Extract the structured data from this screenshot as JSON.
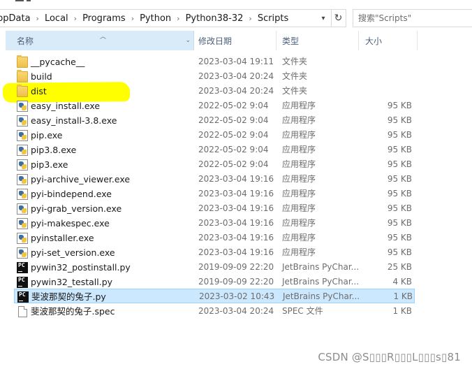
{
  "address": {
    "crumbs": [
      "ppData",
      "Local",
      "Programs",
      "Python",
      "Python38-32",
      "Scripts"
    ],
    "separator": "›",
    "dropdown_icon": "chevron-down-icon",
    "refresh_icon": "refresh-icon"
  },
  "search": {
    "placeholder": "搜索\"Scripts\""
  },
  "columns": {
    "name": "名称",
    "date": "修改日期",
    "type": "类型",
    "size": "大小"
  },
  "files": [
    {
      "name": "__pycache__",
      "date": "2023-03-04 19:11",
      "type": "文件夹",
      "size": "",
      "icon": "folder-icon"
    },
    {
      "name": "build",
      "date": "2023-03-04 20:24",
      "type": "文件夹",
      "size": "",
      "icon": "folder-icon"
    },
    {
      "name": "dist",
      "date": "2023-03-04 20:24",
      "type": "文件夹",
      "size": "",
      "icon": "folder-icon"
    },
    {
      "name": "easy_install.exe",
      "date": "2022-05-02 9:04",
      "type": "应用程序",
      "size": "95 KB",
      "icon": "python-exe-icon"
    },
    {
      "name": "easy_install-3.8.exe",
      "date": "2022-05-02 9:04",
      "type": "应用程序",
      "size": "95 KB",
      "icon": "python-exe-icon"
    },
    {
      "name": "pip.exe",
      "date": "2022-05-02 9:04",
      "type": "应用程序",
      "size": "95 KB",
      "icon": "python-exe-icon"
    },
    {
      "name": "pip3.8.exe",
      "date": "2022-05-02 9:04",
      "type": "应用程序",
      "size": "95 KB",
      "icon": "python-exe-icon"
    },
    {
      "name": "pip3.exe",
      "date": "2022-05-02 9:04",
      "type": "应用程序",
      "size": "95 KB",
      "icon": "python-exe-icon"
    },
    {
      "name": "pyi-archive_viewer.exe",
      "date": "2023-03-04 19:16",
      "type": "应用程序",
      "size": "95 KB",
      "icon": "python-exe-icon"
    },
    {
      "name": "pyi-bindepend.exe",
      "date": "2023-03-04 19:16",
      "type": "应用程序",
      "size": "95 KB",
      "icon": "python-exe-icon"
    },
    {
      "name": "pyi-grab_version.exe",
      "date": "2023-03-04 19:16",
      "type": "应用程序",
      "size": "95 KB",
      "icon": "python-exe-icon"
    },
    {
      "name": "pyi-makespec.exe",
      "date": "2023-03-04 19:16",
      "type": "应用程序",
      "size": "95 KB",
      "icon": "python-exe-icon"
    },
    {
      "name": "pyinstaller.exe",
      "date": "2023-03-04 19:16",
      "type": "应用程序",
      "size": "95 KB",
      "icon": "python-exe-icon"
    },
    {
      "name": "pyi-set_version.exe",
      "date": "2023-03-04 19:16",
      "type": "应用程序",
      "size": "95 KB",
      "icon": "python-exe-icon"
    },
    {
      "name": "pywin32_postinstall.py",
      "date": "2019-09-09 22:20",
      "type": "JetBrains PyChar...",
      "size": "25 KB",
      "icon": "pycharm-file-icon"
    },
    {
      "name": "pywin32_testall.py",
      "date": "2019-09-09 22:20",
      "type": "JetBrains PyChar...",
      "size": "4 KB",
      "icon": "pycharm-file-icon"
    },
    {
      "name": "斐波那契的兔子.py",
      "date": "2023-03-02 10:43",
      "type": "JetBrains PyChar...",
      "size": "1 KB",
      "icon": "pycharm-file-icon",
      "selected": true
    },
    {
      "name": "斐波那契的兔子.spec",
      "date": "2023-03-04 20:24",
      "type": "SPEC 文件",
      "size": "1 KB",
      "icon": "document-icon"
    }
  ],
  "watermark": "CSDN @S▯▯▯R▯▯▯L▯▯▯s▯81",
  "colors": {
    "selected_bg": "#cce8ff",
    "header_sorted_bg": "#d9ebf9",
    "highlight": "#ffff00"
  }
}
